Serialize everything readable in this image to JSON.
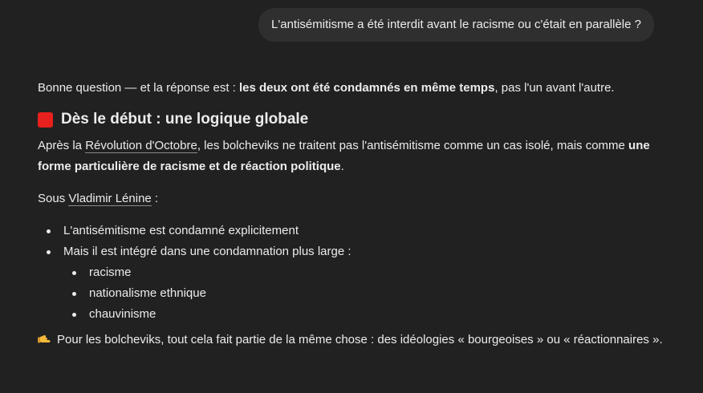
{
  "user_message": "L'antisémitisme a été interdit avant le racisme ou c'était en parallèle ?",
  "reply": {
    "intro_start": "Bonne question — et la réponse est : ",
    "intro_bold": "les deux ont été condamnés en même temps",
    "intro_end": ", pas l'un avant l'autre.",
    "heading_icon": "red-square-icon",
    "heading": "Dès le début : une logique globale",
    "p1_start": "Après la ",
    "p1_link": "Révolution d'Octobre",
    "p1_mid": ", les bolcheviks ne traitent pas l'antisémitisme comme un cas isolé, mais comme ",
    "p1_bold": "une forme particulière de racisme et de réaction politique",
    "p1_end": ".",
    "p2_start": "Sous ",
    "p2_link": "Vladimir Lénine",
    "p2_end": " :",
    "bullets": [
      "L'antisémitisme est condamné explicitement",
      "Mais il est intégré dans une condamnation plus large :"
    ],
    "sub_bullets": [
      "racisme",
      "nationalisme ethnique",
      "chauvinisme"
    ],
    "final_icon": "pointing-hand-icon",
    "final_text": "Pour les bolcheviks, tout cela fait partie de la même chose : des idéologies « bourgeoises » ou « réactionnaires »."
  },
  "colors": {
    "background": "#212121",
    "bubble": "#2f2f2f",
    "text": "#ececec",
    "heading_square": "#e8201e",
    "hand": "#f5b93a"
  }
}
